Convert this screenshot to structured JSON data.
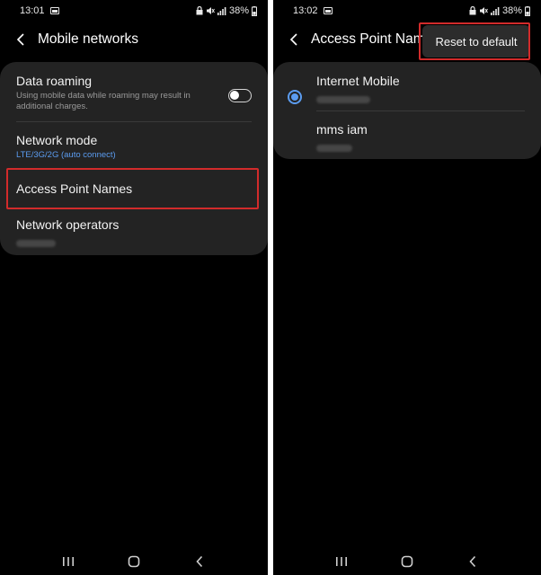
{
  "left": {
    "status": {
      "time": "13:01",
      "battery": "38%"
    },
    "app_bar": {
      "title": "Mobile networks"
    },
    "items": {
      "data_roaming": {
        "title": "Data roaming",
        "subtitle": "Using mobile data while roaming may result in additional charges.",
        "toggle_on": false
      },
      "network_mode": {
        "title": "Network mode",
        "subtitle": "LTE/3G/2G (auto connect)"
      },
      "access_point_names": {
        "title": "Access Point Names"
      },
      "network_operators": {
        "title": "Network operators"
      }
    }
  },
  "right": {
    "status": {
      "time": "13:02",
      "battery": "38%"
    },
    "app_bar": {
      "title": "Access Point Nam"
    },
    "menu": {
      "reset_label": "Reset to default"
    },
    "apns": [
      {
        "name": "Internet Mobile",
        "selected": true
      },
      {
        "name": "mms iam",
        "selected": false
      }
    ]
  },
  "colors": {
    "accent_blue": "#5b9cf0",
    "highlight_red": "#d22b2b",
    "card": "#232323"
  },
  "icons": [
    "back-arrow-icon",
    "gallery-icon",
    "lock-icon",
    "mute-icon",
    "signal-icon",
    "battery-icon",
    "recents-icon",
    "home-icon",
    "nav-back-icon"
  ]
}
